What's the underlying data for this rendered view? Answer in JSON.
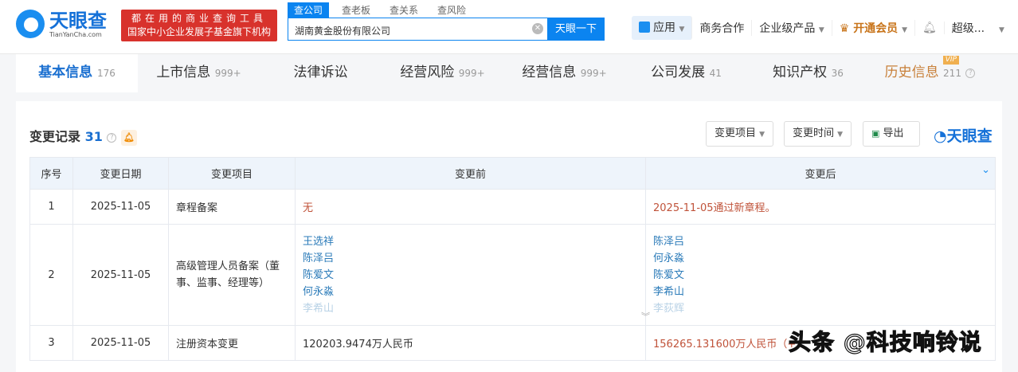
{
  "header": {
    "logo_cn": "天眼查",
    "logo_en": "TianYanCha.com",
    "slogan1": "都在用的商业查询工具",
    "slogan2": "国家中小企业发展子基金旗下机构",
    "search_tabs": [
      "查公司",
      "查老板",
      "查关系",
      "查风险"
    ],
    "search_value": "湖南黄金股份有限公司",
    "search_button": "天眼一下",
    "nav": {
      "apps": "应用",
      "business": "商务合作",
      "enterprise": "企业级产品",
      "vip": "开通会员",
      "user": "超级..."
    }
  },
  "tabs": [
    {
      "label": "基本信息",
      "count": "176"
    },
    {
      "label": "上市信息",
      "count": "999+"
    },
    {
      "label": "法律诉讼",
      "count": ""
    },
    {
      "label": "经营风险",
      "count": "999+"
    },
    {
      "label": "经营信息",
      "count": "999+"
    },
    {
      "label": "公司发展",
      "count": "41"
    },
    {
      "label": "知识产权",
      "count": "36"
    },
    {
      "label": "历史信息",
      "count": "211",
      "badge": "VIP"
    }
  ],
  "section": {
    "title": "变更记录",
    "count": "31",
    "filter_item": "变更项目",
    "filter_time": "变更时间",
    "export": "导出",
    "brand": "天眼查"
  },
  "table": {
    "headers": [
      "序号",
      "变更日期",
      "变更项目",
      "变更前",
      "变更后"
    ],
    "rows": [
      {
        "no": "1",
        "date": "2025-11-05",
        "item": "章程备案",
        "before": [
          "无"
        ],
        "after": [
          "2025-11-05通过新章程。"
        ]
      },
      {
        "no": "2",
        "date": "2025-11-05",
        "item": "高级管理人员备案（董事、监事、经理等）",
        "before": [
          "王选祥",
          "陈泽吕",
          "陈爱文",
          "何永淼",
          "李希山"
        ],
        "after": [
          "陈泽吕",
          "何永淼",
          "陈爱文",
          "李希山",
          "李荻辉"
        ]
      },
      {
        "no": "3",
        "date": "2025-11-05",
        "item": "注册资本变更",
        "before": [
          "120203.9474万人民币"
        ],
        "after": [
          "156265.131600万人民币（+..."
        ]
      }
    ]
  },
  "watermark": "头条 @科技响铃说"
}
